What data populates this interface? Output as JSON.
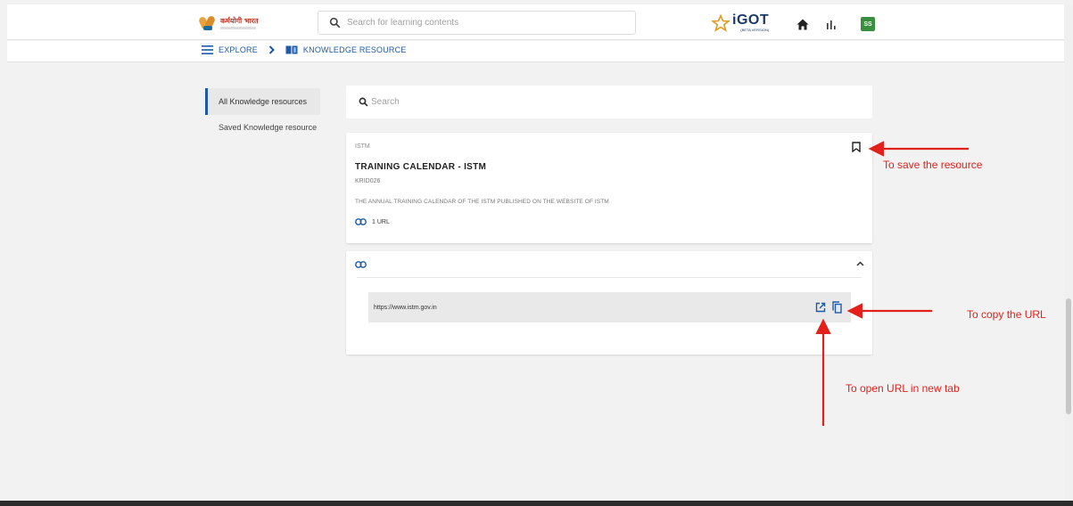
{
  "header": {
    "logo_text": "कर्मयोगी भारत",
    "search_placeholder": "Search for learning contents",
    "brand_name": "iGOT",
    "brand_sub": "(BETA VERSION)",
    "avatar_initials": "SS"
  },
  "breadcrumb": {
    "explore": "EXPLORE",
    "current": "KNOWLEDGE RESOURCE"
  },
  "sidebar": {
    "items": [
      {
        "label": "All Knowledge resources",
        "active": true
      },
      {
        "label": "Saved Knowledge resource",
        "active": false
      }
    ]
  },
  "search": {
    "placeholder": "Search"
  },
  "resource": {
    "org": "ISTM",
    "title": "TRAINING CALENDAR - ISTM",
    "id": "KRID026",
    "description": "THE ANNUAL TRAINING CALENDAR OF THE ISTM PUBLISHED ON THE WEBSITE OF ISTM",
    "url_count": "1 URL"
  },
  "url_panel": {
    "url": "https://www.istm.gov.in"
  },
  "annotations": {
    "save": "To save the resource",
    "copy": "To copy the URL",
    "open": "To open URL in new tab"
  },
  "colors": {
    "accent": "#1f5aa8",
    "annotation": "#e3201b",
    "avatar_bg": "#3a8f3c"
  }
}
